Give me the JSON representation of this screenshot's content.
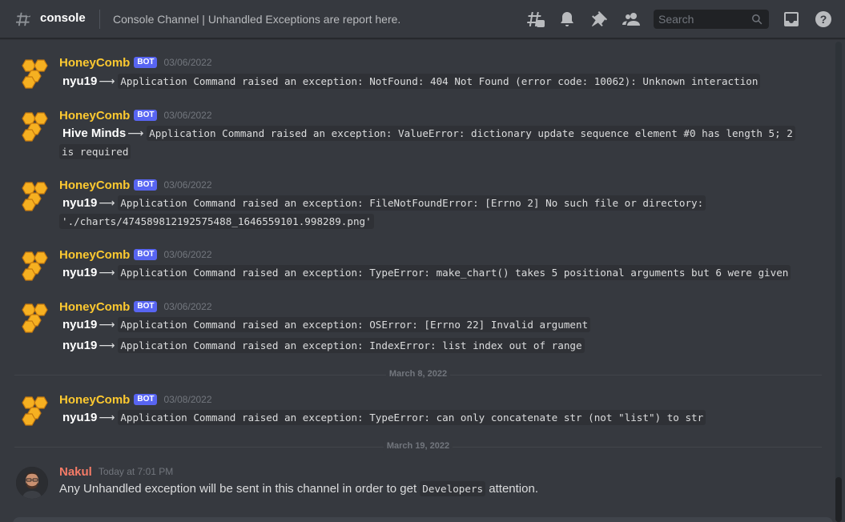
{
  "header": {
    "channel": "console",
    "topic": "Console Channel | Unhandled Exceptions are report here.",
    "search_placeholder": "Search",
    "icons": [
      "threads-icon",
      "bell-icon",
      "pin-icon",
      "members-icon",
      "search-icon",
      "inbox-icon",
      "help-icon"
    ]
  },
  "colors": {
    "bot_name": "#fdc930",
    "user_name": "#f47b67",
    "bot_tag": "#5865f2",
    "background": "#36393f"
  },
  "messages": [
    {
      "author": "HoneyComb",
      "tag": "BOT",
      "time": "03/06/2022",
      "lines": [
        {
          "who": "nyu19",
          "arrow": "⟶",
          "text": "Application Command raised an exception: NotFound: 404 Not Found (error code: 10062): Unknown interaction"
        }
      ]
    },
    {
      "author": "HoneyComb",
      "tag": "BOT",
      "time": "03/06/2022",
      "lines": [
        {
          "who": "Hive Minds",
          "arrow": "⟶",
          "text": "Application Command raised an exception: ValueError: dictionary update sequence element #0 has length 5; 2 is required"
        }
      ]
    },
    {
      "author": "HoneyComb",
      "tag": "BOT",
      "time": "03/06/2022",
      "lines": [
        {
          "who": "nyu19",
          "arrow": "⟶",
          "text": "Application Command raised an exception: FileNotFoundError: [Errno 2] No such file or directory: './charts/474589812192575488_1646559101.998289.png'"
        }
      ]
    },
    {
      "author": "HoneyComb",
      "tag": "BOT",
      "time": "03/06/2022",
      "lines": [
        {
          "who": "nyu19",
          "arrow": "⟶",
          "text": "Application Command raised an exception: TypeError: make_chart() takes 5 positional arguments but 6 were given"
        }
      ]
    },
    {
      "author": "HoneyComb",
      "tag": "BOT",
      "time": "03/06/2022",
      "lines": [
        {
          "who": "nyu19",
          "arrow": "⟶",
          "text": "Application Command raised an exception: OSError: [Errno 22] Invalid argument"
        },
        {
          "who": "nyu19",
          "arrow": "⟶",
          "text": "Application Command raised an exception: IndexError: list index out of range"
        }
      ]
    },
    {
      "author": "HoneyComb",
      "tag": "BOT",
      "time": "03/08/2022",
      "lines": [
        {
          "who": "nyu19",
          "arrow": "⟶",
          "text": "Application Command raised an exception: TypeError: can only concatenate str (not \"list\") to str"
        }
      ]
    }
  ],
  "separators": [
    "March 8, 2022",
    "March 19, 2022"
  ],
  "user_message": {
    "author": "Nakul",
    "time": "Today at 7:01 PM",
    "text_before": "Any Unhandled exception will be sent in this channel in order to get ",
    "code": "Developers",
    "text_after": " attention."
  }
}
